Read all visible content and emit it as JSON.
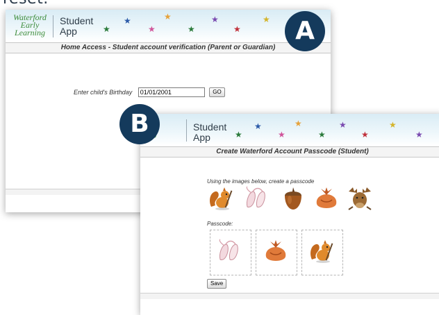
{
  "intro_text": "reset.",
  "window_a": {
    "logo_lines": [
      "Waterford",
      "Early",
      "Learning"
    ],
    "app_name_lines": [
      "Student",
      "App"
    ],
    "subtitle": "Home Access - Student account verification (Parent or Guardian)",
    "birthday_label": "Enter child's Birthday",
    "birthday_value": "01/01/2001",
    "go_label": "GO",
    "badge": "A"
  },
  "window_b": {
    "logo_lines": [
      "d",
      "ng"
    ],
    "app_name_lines": [
      "Student",
      "App"
    ],
    "subtitle": "Create Waterford Account Passcode (Student)",
    "instruction": "Using the images below, create a passcode",
    "image_choices": [
      "squirrel",
      "ballet-shoes",
      "acorn",
      "pouch",
      "moose"
    ],
    "passcode_label": "Passcode:",
    "passcode_images": [
      "ballet-shoes",
      "pouch",
      "squirrel"
    ],
    "save_label": "Save",
    "badge": "B"
  },
  "colors": {
    "badge": "#143a5c",
    "logo_green": "#3c8c3a",
    "banner_blue": "#d9ecf5"
  }
}
